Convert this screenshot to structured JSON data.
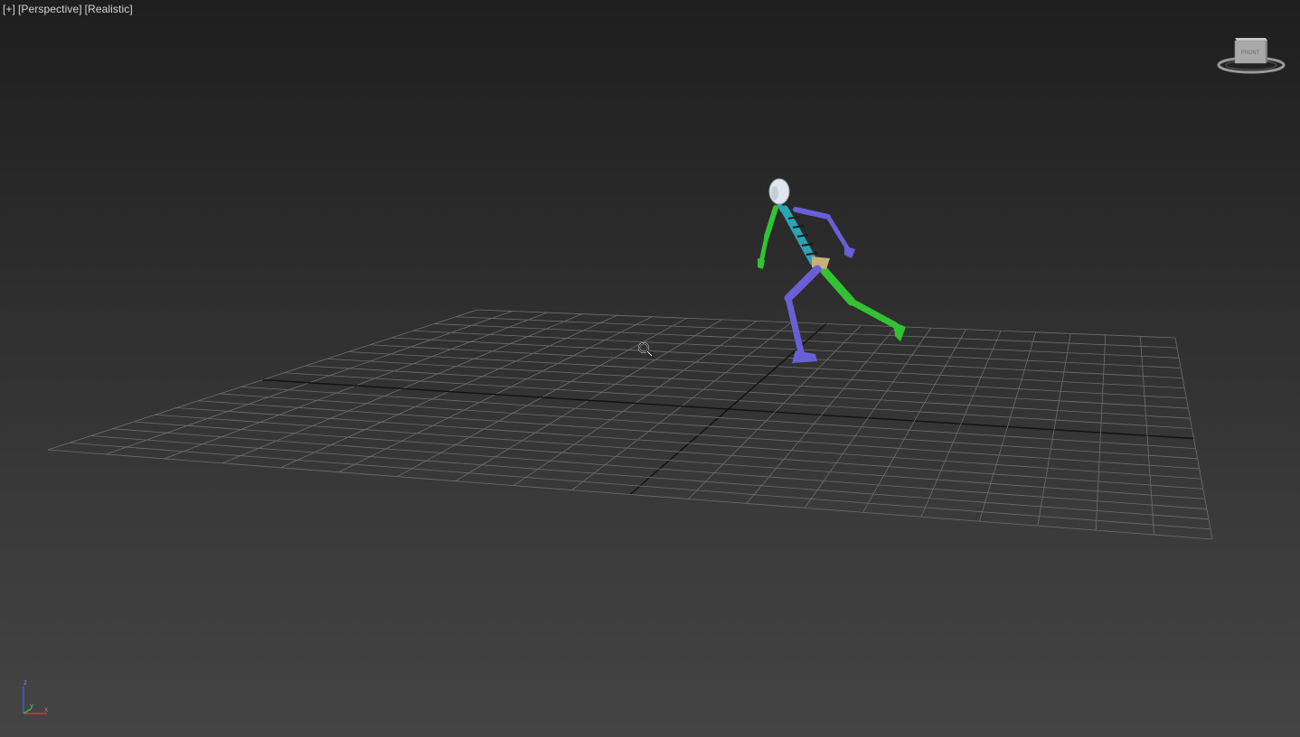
{
  "viewport": {
    "labels": [
      "[+]",
      "[Perspective]",
      "[Realistic]"
    ]
  },
  "viewcube": {
    "face_label": "FRONT"
  },
  "axis_tripod": {
    "z_label": "z",
    "y_label": "y",
    "x_label": "x"
  },
  "colors": {
    "grid_line": "#6e6e6e",
    "grid_axis": "#111111",
    "biped_left": "#33c233",
    "biped_right": "#6b5fd6",
    "spine": "#2aa3b5",
    "head": "#dfe6ee"
  },
  "icons": {
    "cursor": "zoom-magnifier-icon"
  }
}
